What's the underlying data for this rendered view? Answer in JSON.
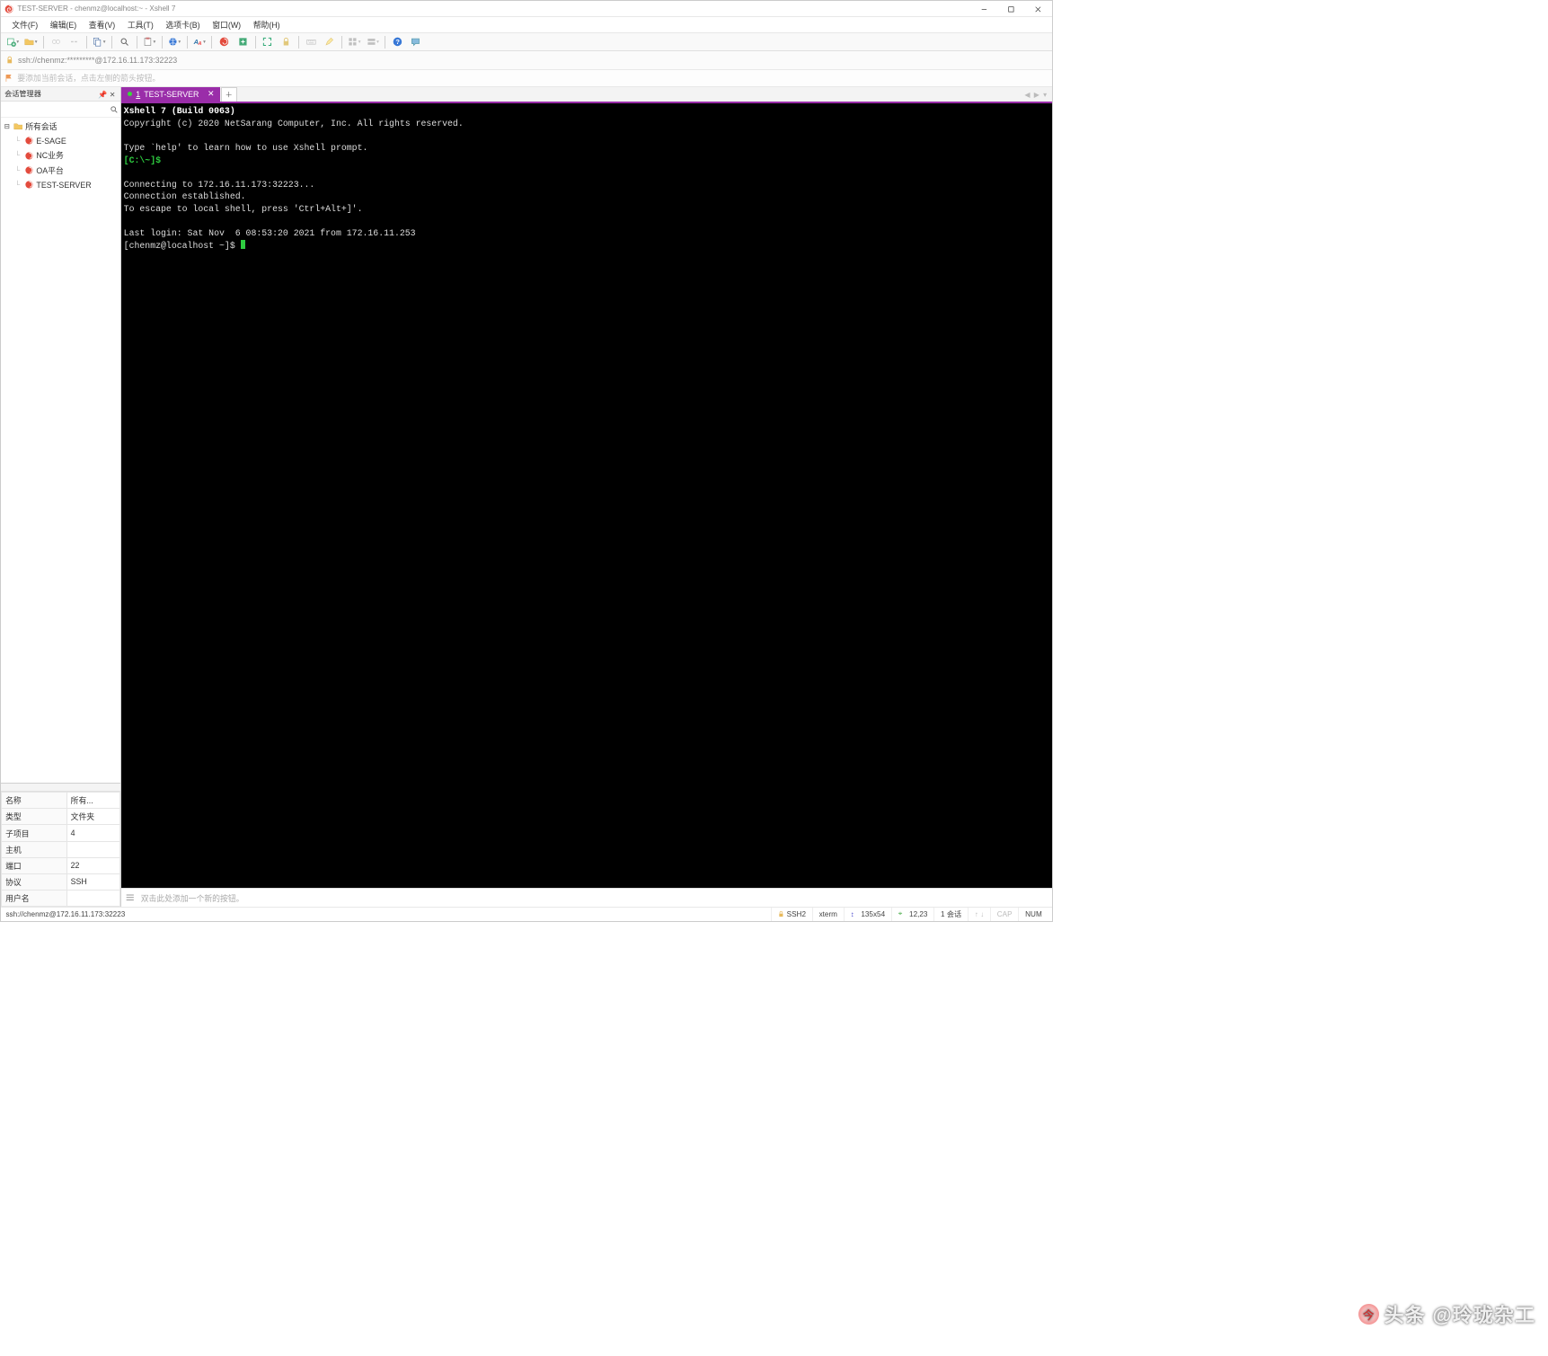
{
  "window": {
    "title": "TEST-SERVER - chenmz@localhost:~ - Xshell 7"
  },
  "menu": [
    "文件(F)",
    "编辑(E)",
    "查看(V)",
    "工具(T)",
    "选项卡(B)",
    "窗口(W)",
    "帮助(H)"
  ],
  "address": "ssh://chenmz:*********@172.16.11.173:32223",
  "hint": "要添加当前会话，点击左侧的箭头按钮。",
  "sidebar": {
    "title": "会话管理器",
    "root": "所有会话",
    "items": [
      "E-SAGE",
      "NC业务",
      "OA平台",
      "TEST-SERVER"
    ]
  },
  "props": {
    "header_k": "名称",
    "header_v": "所有...",
    "rows": [
      {
        "k": "类型",
        "v": "文件夹"
      },
      {
        "k": "子项目",
        "v": "4"
      },
      {
        "k": "主机",
        "v": ""
      },
      {
        "k": "端口",
        "v": "22"
      },
      {
        "k": "协议",
        "v": "SSH"
      },
      {
        "k": "用户名",
        "v": ""
      }
    ]
  },
  "tab": {
    "index": "1",
    "label": "TEST-SERVER"
  },
  "terminal": {
    "l1": "Xshell 7 (Build 0063)",
    "l2": "Copyright (c) 2020 NetSarang Computer, Inc. All rights reserved.",
    "l3": "Type `help' to learn how to use Xshell prompt.",
    "l4": "[C:\\~]$",
    "l5": "Connecting to 172.16.11.173:32223...",
    "l6": "Connection established.",
    "l7": "To escape to local shell, press 'Ctrl+Alt+]'.",
    "l8": "Last login: Sat Nov  6 08:53:20 2021 from 172.16.11.253",
    "l9": "[chenmz@localhost ~]$ "
  },
  "bottom_hint": "双击此处添加一个新的按钮。",
  "watermark": "头条 @玲珑杂工",
  "status": {
    "path": "ssh://chenmz@172.16.11.173:32223",
    "proto": "SSH2",
    "term": "xterm",
    "size": "135x54",
    "rc": "12,23",
    "sess": "1 会话",
    "cap": "CAP",
    "num": "NUM"
  }
}
